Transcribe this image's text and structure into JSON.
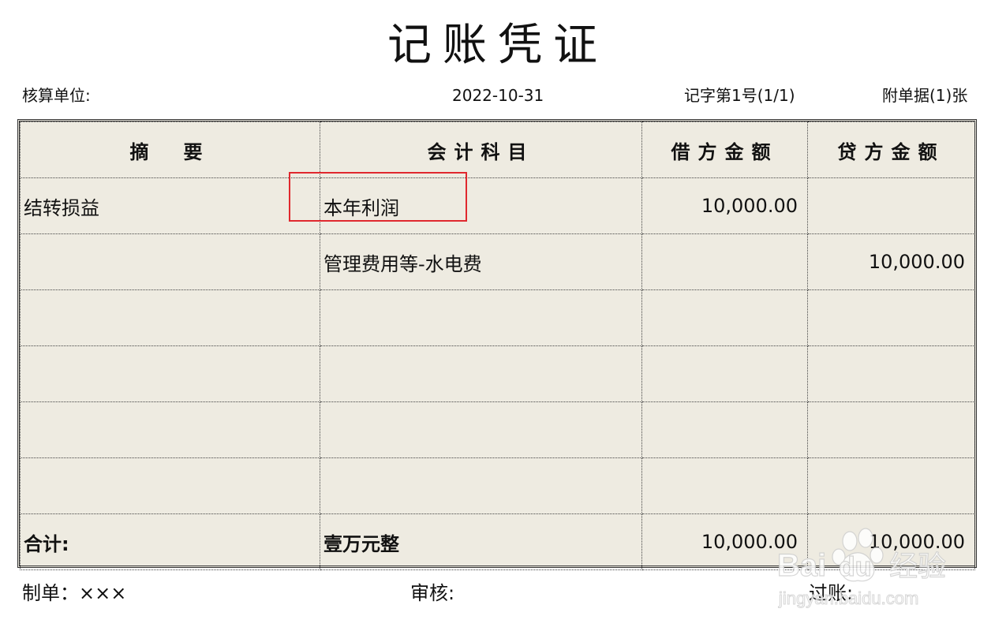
{
  "title": "记账凭证",
  "header": {
    "unit_label": "核算单位:",
    "date": "2022-10-31",
    "voucher_no": "记字第1号(1/1)",
    "attachments": "附单据(1)张"
  },
  "table": {
    "columns": [
      "摘　要",
      "会计科目",
      "借方金额",
      "贷方金额"
    ],
    "rows": [
      {
        "summary": "结转损益",
        "account": "本年利润",
        "debit": "10,000.00",
        "credit": ""
      },
      {
        "summary": "",
        "account": "管理费用等-水电费",
        "debit": "",
        "credit": "10,000.00"
      },
      {
        "summary": "",
        "account": "",
        "debit": "",
        "credit": ""
      },
      {
        "summary": "",
        "account": "",
        "debit": "",
        "credit": ""
      },
      {
        "summary": "",
        "account": "",
        "debit": "",
        "credit": ""
      },
      {
        "summary": "",
        "account": "",
        "debit": "",
        "credit": ""
      }
    ],
    "total": {
      "label": "合计:",
      "amount_words": "壹万元整",
      "debit": "10,000.00",
      "credit": "10,000.00"
    }
  },
  "footer": {
    "maker": "制单：×××",
    "auditor": "审核:",
    "poster": "过账:"
  },
  "watermark": {
    "brand_text": "Bai 经验",
    "url_text": "jingyan.baidu.com"
  },
  "colors": {
    "table_bg": "#eeebe1",
    "highlight": "#e0282e"
  }
}
